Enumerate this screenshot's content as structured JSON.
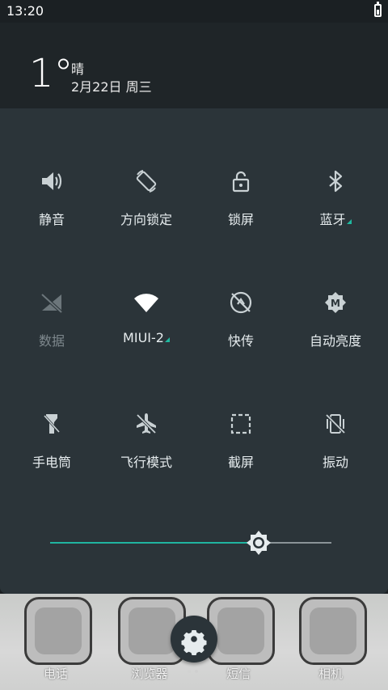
{
  "status_bar": {
    "time": "13:20"
  },
  "weather": {
    "temperature": "1°",
    "condition": "晴",
    "date": "2月22日 周三"
  },
  "tiles": [
    {
      "label": "静音",
      "icon": "volume-icon",
      "active": true
    },
    {
      "label": "方向锁定",
      "icon": "rotation-lock-icon",
      "active": true
    },
    {
      "label": "锁屏",
      "icon": "lock-icon",
      "active": true
    },
    {
      "label": "蓝牙",
      "icon": "bluetooth-icon",
      "active": true
    },
    {
      "label": "数据",
      "icon": "mobile-data-off-icon",
      "active": false
    },
    {
      "label": "MIUI-2",
      "icon": "wifi-icon",
      "active": true
    },
    {
      "label": "快传",
      "icon": "quick-transfer-icon",
      "active": true
    },
    {
      "label": "自动亮度",
      "icon": "auto-brightness-icon",
      "active": true
    },
    {
      "label": "手电筒",
      "icon": "flashlight-icon",
      "active": true
    },
    {
      "label": "飞行模式",
      "icon": "airplane-off-icon",
      "active": true
    },
    {
      "label": "截屏",
      "icon": "screenshot-icon",
      "active": true
    },
    {
      "label": "振动",
      "icon": "vibrate-off-icon",
      "active": true
    }
  ],
  "brightness": {
    "level": 0.74
  },
  "dock": [
    {
      "label": "电话"
    },
    {
      "label": "浏览器"
    },
    {
      "label": "短信"
    },
    {
      "label": "相机"
    }
  ],
  "colors": {
    "accent": "#20b4a0",
    "panel": "#2b3439",
    "header": "#1f2528"
  }
}
